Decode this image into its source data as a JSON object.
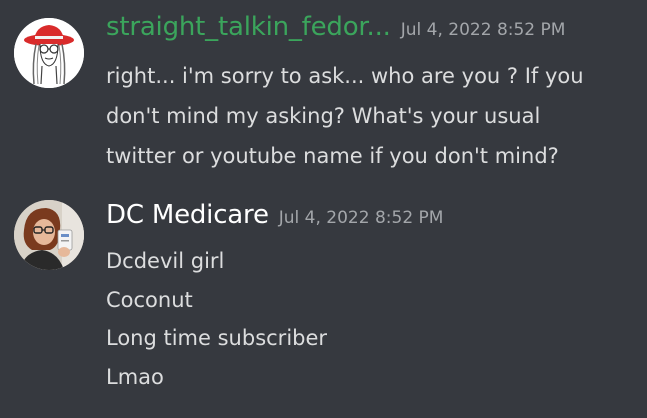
{
  "messages": [
    {
      "username": "straight_talkin_fedor...",
      "timestamp": "Jul 4, 2022 8:52 PM",
      "username_color": "#3ba55c",
      "avatar": "red-hat-cartoon-avatar-icon",
      "lines": [
        "right... i'm sorry to ask... who are you ? If you",
        "don't mind my asking? What's your usual",
        "twitter or youtube name if you don't mind?"
      ]
    },
    {
      "username": "DC Medicare",
      "timestamp": "Jul 4, 2022 8:52 PM",
      "username_color": "#ffffff",
      "avatar": "person-photo-avatar-icon",
      "lines": [
        "Dcdevil girl",
        "Coconut",
        "Long time subscriber",
        "Lmao"
      ]
    }
  ],
  "colors": {
    "background": "#36393f",
    "message_text": "#dcddde",
    "timestamp_text": "#a3a6aa"
  }
}
